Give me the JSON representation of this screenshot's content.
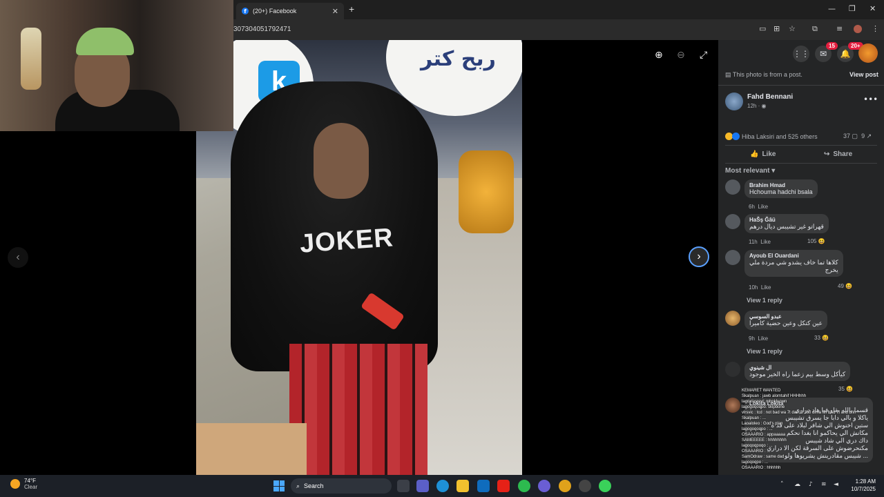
{
  "browser": {
    "tab_title": "(20+) Facebook",
    "tab_favicon": "f",
    "address": "307304051792471",
    "new_tab_icon": "plus-icon",
    "minimize": "—",
    "maximize": "❐",
    "close": "✕"
  },
  "viewer": {
    "sign_letter": "k",
    "sign_text": "ربح كتر",
    "shirt_text": "JOKER",
    "zoom_in": "⊕",
    "zoom_out": "⊖",
    "fullscreen": "⤢",
    "prev": "‹",
    "next": "›"
  },
  "fb": {
    "messenger_badge": "15",
    "notifications_badge": "20+",
    "post_note": "This photo is from a post.",
    "view_post": "View post",
    "author": "Fahd Bennani",
    "post_time": "12h · ",
    "reactions_text": "Hiba Laksiri and 525 others",
    "comment_count": "37",
    "share_count": "9",
    "like_label": "Like",
    "share_label": "Share",
    "sort_label": "Most relevant",
    "comments": [
      {
        "name": "Brahim Hmad",
        "text": "Hchouma hadchi bsala",
        "time": "6h",
        "like": "Like",
        "reacts": ""
      },
      {
        "name": "HaŠş Ğâü",
        "text": "قهراتو غير تشيبس ديال درهم",
        "time": "11h",
        "like": "Like",
        "reacts": "105"
      },
      {
        "name": "Ayoub El Ouardani",
        "text": "كلاها تما خاف يشدو شي مردة ملي",
        "text2": "يخرج",
        "time": "10h",
        "like": "Like",
        "reacts": "49"
      },
      {
        "name": "عبدو السوسي",
        "text": "عين كتكل وعين حضية كاميرا",
        "time": "9h",
        "like": "Like",
        "reacts": "33"
      },
      {
        "name": "ال شينوي",
        "text": "كيأكل وسط بيم زعما راه الخير موجود",
        "time": "",
        "like": "",
        "reacts": "35"
      },
      {
        "name": "Lokita Lokita",
        "text": "قسما بالله يقاو فيا هاد دراري",
        "text2": "ياكلا و بالي دابا جا يسرق تشيبس",
        "text3": "ستين اخنوش الي شافر لبلاد على قد ه",
        "text4": "مكانش الي يحاكمو انا بغدا نحكم",
        "text5": "داك دري الي شاد شيبس",
        "text6": "مكنحرضوش على السرقة لكن الا دراري",
        "text7": "شيبس مقادرينش يشريوها ولو ...",
        "time": "",
        "like": "",
        "reacts": ""
      }
    ],
    "view_reply": "View 1 reply"
  },
  "chat": [
    "KEMARET WANTED",
    "Skalpuan : jawb alomtahif HHHhhh",
    "lagoxlasrevl: mbpkluown",
    "lagogoqoqpo: skipbone",
    "vlrsvic : tcd : not bad wa 7t dari l3 160 dima fih bAd 7! and bhh",
    "Skalpuan : ...",
    "Laoaloleo : God's plan",
    "lagogoqoqpo : ...",
    "OSAAARIO : appaaaaa",
    "SAMEEEEE : hhhhhhhh",
    "lagoqoqpoqo : ...",
    "OSAAARIO : ...",
    "SamOdraw : same dad",
    "lagoqoqpo : ...",
    "OSAAARIO : hhhhhh"
  ],
  "taskbar": {
    "temp": "74°F",
    "condition": "Clear",
    "search_label": "Search",
    "time": "1:28 AM",
    "date": "10/7/2025"
  }
}
